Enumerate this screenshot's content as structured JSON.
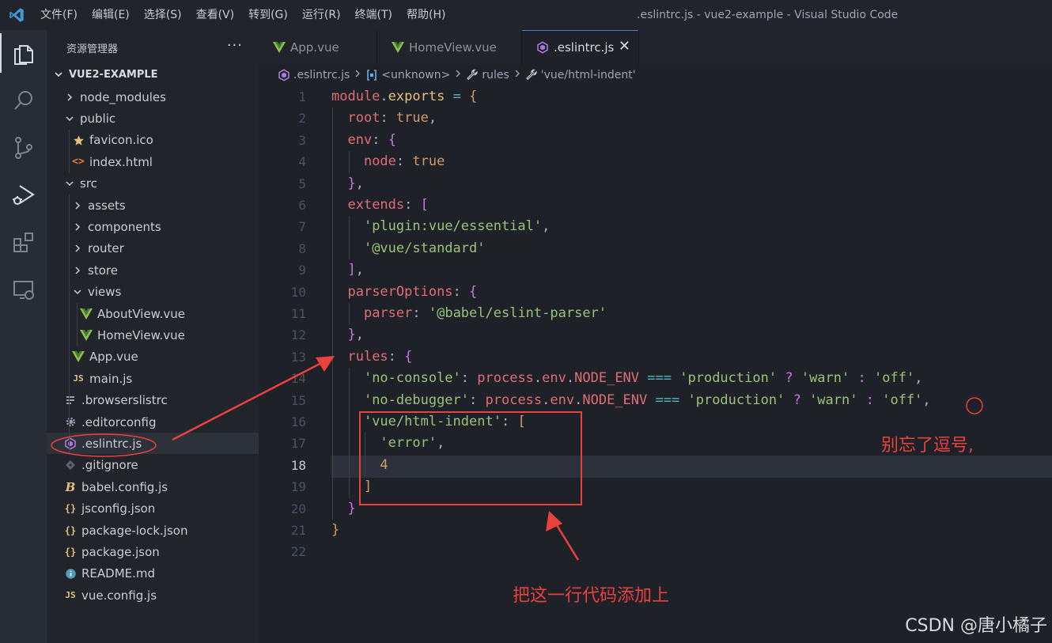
{
  "titlebar": {
    "menus": [
      "文件(F)",
      "编辑(E)",
      "选择(S)",
      "查看(V)",
      "转到(G)",
      "运行(R)",
      "终端(T)",
      "帮助(H)"
    ],
    "window_title": ".eslintrc.js - vue2-example - Visual Studio Code"
  },
  "sidebar": {
    "title": "资源管理器",
    "more": "···",
    "root": "VUE2-EXAMPLE",
    "tree": [
      {
        "label": "node_modules",
        "kind": "folder",
        "depth": 0,
        "open": false
      },
      {
        "label": "public",
        "kind": "folder",
        "depth": 0,
        "open": true
      },
      {
        "label": "favicon.ico",
        "kind": "star",
        "depth": 1
      },
      {
        "label": "index.html",
        "kind": "html",
        "depth": 1
      },
      {
        "label": "src",
        "kind": "folder",
        "depth": 0,
        "open": true
      },
      {
        "label": "assets",
        "kind": "folder",
        "depth": 1,
        "open": false
      },
      {
        "label": "components",
        "kind": "folder",
        "depth": 1,
        "open": false
      },
      {
        "label": "router",
        "kind": "folder",
        "depth": 1,
        "open": false
      },
      {
        "label": "store",
        "kind": "folder",
        "depth": 1,
        "open": false
      },
      {
        "label": "views",
        "kind": "folder",
        "depth": 1,
        "open": true
      },
      {
        "label": "AboutView.vue",
        "kind": "vue",
        "depth": 2
      },
      {
        "label": "HomeView.vue",
        "kind": "vue",
        "depth": 2
      },
      {
        "label": "App.vue",
        "kind": "vue",
        "depth": 1
      },
      {
        "label": "main.js",
        "kind": "js",
        "depth": 1
      },
      {
        "label": ".browserslistrc",
        "kind": "lines",
        "depth": 0
      },
      {
        "label": ".editorconfig",
        "kind": "gear",
        "depth": 0
      },
      {
        "label": ".eslintrc.js",
        "kind": "eslint",
        "depth": 0,
        "selected": true
      },
      {
        "label": ".gitignore",
        "kind": "git",
        "depth": 0
      },
      {
        "label": "babel.config.js",
        "kind": "babel",
        "depth": 0
      },
      {
        "label": "jsconfig.json",
        "kind": "json",
        "depth": 0
      },
      {
        "label": "package-lock.json",
        "kind": "json",
        "depth": 0
      },
      {
        "label": "package.json",
        "kind": "json",
        "depth": 0
      },
      {
        "label": "README.md",
        "kind": "info",
        "depth": 0
      },
      {
        "label": "vue.config.js",
        "kind": "js",
        "depth": 0
      }
    ]
  },
  "tabs": [
    {
      "label": "App.vue",
      "icon": "vue",
      "active": false
    },
    {
      "label": "HomeView.vue",
      "icon": "vue",
      "active": false
    },
    {
      "label": ".eslintrc.js",
      "icon": "eslint",
      "active": true,
      "close": "✕"
    }
  ],
  "breadcrumb": [
    {
      "label": ".eslintrc.js",
      "icon": "eslint"
    },
    {
      "label": "<unknown>",
      "icon": "object"
    },
    {
      "label": "rules",
      "icon": "wrench"
    },
    {
      "label": "'vue/html-indent'",
      "icon": "wrench"
    }
  ],
  "editor": {
    "current_line": 18,
    "lines": [
      [
        [
          "module",
          "k"
        ],
        [
          ".",
          "t"
        ],
        [
          "exports",
          "f"
        ],
        [
          " ",
          "t"
        ],
        [
          "=",
          "o"
        ],
        [
          " {",
          "b"
        ]
      ],
      [
        [
          "  ",
          "t"
        ],
        [
          "root",
          "v"
        ],
        [
          ": ",
          "t"
        ],
        [
          "true",
          "n"
        ],
        [
          ",",
          "t"
        ]
      ],
      [
        [
          "  ",
          "t"
        ],
        [
          "env",
          "v"
        ],
        [
          ": ",
          "t"
        ],
        [
          "{",
          "p"
        ]
      ],
      [
        [
          "    ",
          "t"
        ],
        [
          "node",
          "v"
        ],
        [
          ": ",
          "t"
        ],
        [
          "true",
          "n"
        ]
      ],
      [
        [
          "  ",
          "t"
        ],
        [
          "}",
          "p"
        ],
        [
          ",",
          "t"
        ]
      ],
      [
        [
          "  ",
          "t"
        ],
        [
          "extends",
          "v"
        ],
        [
          ": ",
          "t"
        ],
        [
          "[",
          "p"
        ]
      ],
      [
        [
          "    ",
          "t"
        ],
        [
          "'plugin:vue/essential'",
          "s"
        ],
        [
          ",",
          "t"
        ]
      ],
      [
        [
          "    ",
          "t"
        ],
        [
          "'@vue/standard'",
          "s"
        ]
      ],
      [
        [
          "  ",
          "t"
        ],
        [
          "]",
          "p"
        ],
        [
          ",",
          "t"
        ]
      ],
      [
        [
          "  ",
          "t"
        ],
        [
          "parserOptions",
          "v"
        ],
        [
          ": ",
          "t"
        ],
        [
          "{",
          "p"
        ]
      ],
      [
        [
          "    ",
          "t"
        ],
        [
          "parser",
          "v"
        ],
        [
          ": ",
          "t"
        ],
        [
          "'@babel/eslint-parser'",
          "s"
        ]
      ],
      [
        [
          "  ",
          "t"
        ],
        [
          "}",
          "p"
        ],
        [
          ",",
          "t"
        ]
      ],
      [
        [
          "  ",
          "t"
        ],
        [
          "rules",
          "v"
        ],
        [
          ": ",
          "t"
        ],
        [
          "{",
          "p"
        ]
      ],
      [
        [
          "    ",
          "t"
        ],
        [
          "'no-console'",
          "s"
        ],
        [
          ": ",
          "t"
        ],
        [
          "process",
          "k"
        ],
        [
          ".",
          "t"
        ],
        [
          "env",
          "k"
        ],
        [
          ".",
          "t"
        ],
        [
          "NODE_ENV",
          "k"
        ],
        [
          " ",
          "t"
        ],
        [
          "===",
          "o"
        ],
        [
          " ",
          "t"
        ],
        [
          "'production'",
          "s"
        ],
        [
          " ",
          "t"
        ],
        [
          "?",
          "p"
        ],
        [
          " ",
          "t"
        ],
        [
          "'warn'",
          "s"
        ],
        [
          " ",
          "t"
        ],
        [
          ":",
          "p"
        ],
        [
          " ",
          "t"
        ],
        [
          "'off'",
          "s"
        ],
        [
          ",",
          "t"
        ]
      ],
      [
        [
          "    ",
          "t"
        ],
        [
          "'no-debugger'",
          "s"
        ],
        [
          ": ",
          "t"
        ],
        [
          "process",
          "k"
        ],
        [
          ".",
          "t"
        ],
        [
          "env",
          "k"
        ],
        [
          ".",
          "t"
        ],
        [
          "NODE_ENV",
          "k"
        ],
        [
          " ",
          "t"
        ],
        [
          "===",
          "o"
        ],
        [
          " ",
          "t"
        ],
        [
          "'production'",
          "s"
        ],
        [
          " ",
          "t"
        ],
        [
          "?",
          "p"
        ],
        [
          " ",
          "t"
        ],
        [
          "'warn'",
          "s"
        ],
        [
          " ",
          "t"
        ],
        [
          ":",
          "p"
        ],
        [
          " ",
          "t"
        ],
        [
          "'off'",
          "s"
        ],
        [
          ",",
          "t"
        ]
      ],
      [
        [
          "    ",
          "t"
        ],
        [
          "'vue/html-indent'",
          "s"
        ],
        [
          ": ",
          "t"
        ],
        [
          "[",
          "b"
        ]
      ],
      [
        [
          "      ",
          "t"
        ],
        [
          "'error'",
          "s"
        ],
        [
          ",",
          "t"
        ]
      ],
      [
        [
          "      ",
          "t"
        ],
        [
          "4",
          "n"
        ]
      ],
      [
        [
          "    ",
          "t"
        ],
        [
          "]",
          "b"
        ]
      ],
      [
        [
          "  ",
          "t"
        ],
        [
          "}",
          "p"
        ]
      ],
      [
        [
          "}",
          "b"
        ]
      ],
      []
    ]
  },
  "annotations": {
    "comma_note": "别忘了逗号,",
    "add_note": "把这一行代码添加上",
    "color": "#e8413e"
  },
  "watermark": "CSDN @唐小橘子"
}
